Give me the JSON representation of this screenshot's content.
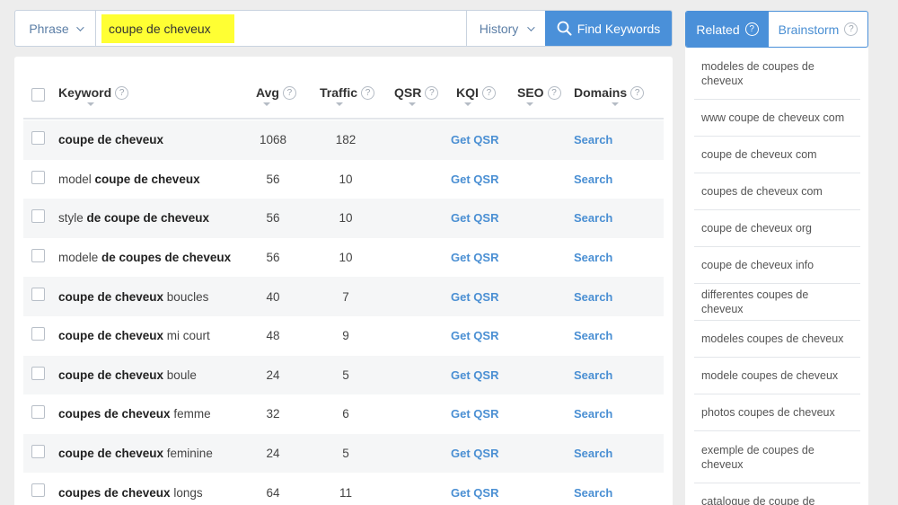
{
  "search": {
    "mode_label": "Phrase",
    "query": "coupe de cheveux",
    "history_label": "History",
    "find_label": "Find Keywords"
  },
  "table": {
    "headers": {
      "keyword": "Keyword",
      "avg": "Avg",
      "traffic": "Traffic",
      "qsr": "QSR",
      "kqi": "KQI",
      "seo": "SEO",
      "domains": "Domains"
    },
    "rows": [
      {
        "prefix": "",
        "bold": "coupe de cheveux",
        "suffix": "",
        "avg": "1068",
        "traffic": "182",
        "kqi": "Get QSR",
        "domains": "Search"
      },
      {
        "prefix": "model ",
        "bold": "coupe de cheveux",
        "suffix": "",
        "avg": "56",
        "traffic": "10",
        "kqi": "Get QSR",
        "domains": "Search"
      },
      {
        "prefix": "style ",
        "bold": "de coupe de cheveux",
        "suffix": "",
        "avg": "56",
        "traffic": "10",
        "kqi": "Get QSR",
        "domains": "Search"
      },
      {
        "prefix": "modele ",
        "bold": "de coupes de cheveux",
        "suffix": "",
        "avg": "56",
        "traffic": "10",
        "kqi": "Get QSR",
        "domains": "Search"
      },
      {
        "prefix": "",
        "bold": "coupe de cheveux",
        "suffix": " boucles",
        "avg": "40",
        "traffic": "7",
        "kqi": "Get QSR",
        "domains": "Search"
      },
      {
        "prefix": "",
        "bold": "coupe de cheveux",
        "suffix": " mi court",
        "avg": "48",
        "traffic": "9",
        "kqi": "Get QSR",
        "domains": "Search"
      },
      {
        "prefix": "",
        "bold": "coupe de cheveux",
        "suffix": " boule",
        "avg": "24",
        "traffic": "5",
        "kqi": "Get QSR",
        "domains": "Search"
      },
      {
        "prefix": "",
        "bold": "coupes de cheveux",
        "suffix": " femme",
        "avg": "32",
        "traffic": "6",
        "kqi": "Get QSR",
        "domains": "Search"
      },
      {
        "prefix": "",
        "bold": "coupe de cheveux",
        "suffix": " feminine",
        "avg": "24",
        "traffic": "5",
        "kqi": "Get QSR",
        "domains": "Search"
      },
      {
        "prefix": "",
        "bold": "coupes de cheveux",
        "suffix": " longs",
        "avg": "64",
        "traffic": "11",
        "kqi": "Get QSR",
        "domains": "Search"
      }
    ]
  },
  "sidebar": {
    "tabs": [
      {
        "label": "Related"
      },
      {
        "label": "Brainstorm"
      }
    ],
    "related": [
      "modeles de coupes de cheveux",
      "www coupe de cheveux com",
      "coupe de cheveux com",
      "coupes de cheveux com",
      "coupe de cheveux org",
      "coupe de cheveux info",
      "differentes coupes de cheveux",
      "modeles coupes de cheveux",
      "modele coupes de cheveux",
      "photos coupes de cheveux",
      "exemple de coupes de cheveux",
      "catalogue de coupe de"
    ]
  },
  "colors": {
    "accent": "#4a90d9",
    "link": "#4a8fd3",
    "highlight": "#ffff33",
    "background": "#ededed"
  }
}
